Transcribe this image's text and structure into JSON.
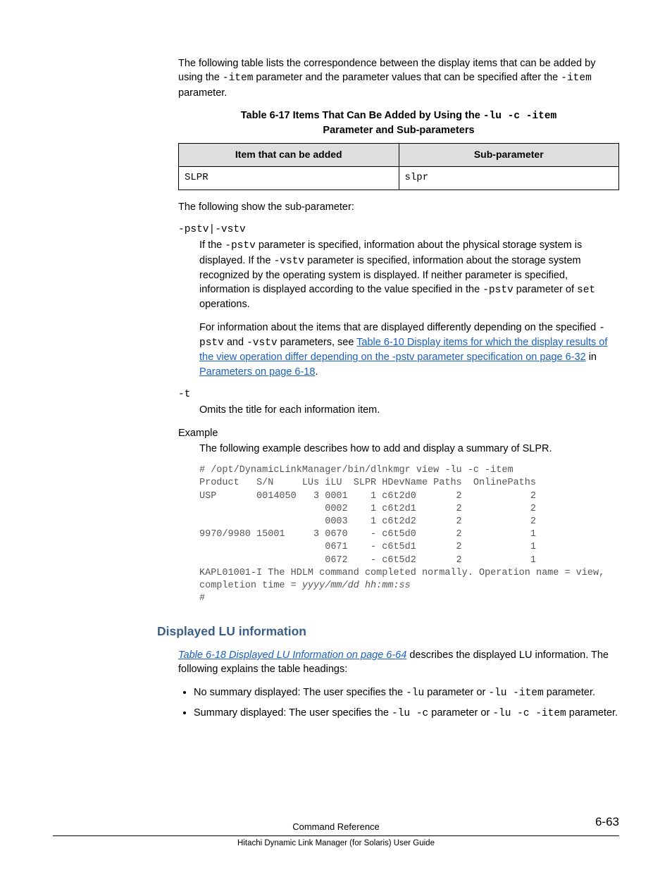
{
  "intro": {
    "p1a": "The following table lists the correspondence between the display items that can be added by using the ",
    "p1_code1": "-item",
    "p1b": " parameter and the parameter values that can be specified after the ",
    "p1_code2": "-item",
    "p1c": " parameter."
  },
  "table617": {
    "caption_a": "Table 6-17 Items That Can Be Added by Using the ",
    "caption_code": "-lu -c -item",
    "caption_b": " Parameter and Sub-parameters",
    "head_item": "Item that can be added",
    "head_sub": "Sub-parameter",
    "row1_item": "SLPR",
    "row1_sub": "slpr"
  },
  "subparam_intro": "The following show the sub-parameter:",
  "pstv": {
    "label": "-pstv|-vstv",
    "p1a": "If the ",
    "p1_c1": "-pstv",
    "p1b": " parameter is specified, information about the physical storage system is displayed. If the ",
    "p1_c2": "-vstv",
    "p1c": " parameter is specified, information about the storage system recognized by the operating system is displayed. If neither parameter is specified, information is displayed according to the value specified in the ",
    "p1_c3": "-pstv",
    "p1d": " parameter of ",
    "p1_c4": "set",
    "p1e": " operations.",
    "p2a": "For information about the items that are displayed differently depending on the specified ",
    "p2_c1": "-pstv",
    "p2b": " and ",
    "p2_c2": "-vstv",
    "p2c": " parameters, see ",
    "p2_link1": "Table 6-10 Display items for which the display results of the view operation differ depending on the -pstv parameter specification on page 6-32",
    "p2d": " in ",
    "p2_link2": "Parameters on page 6-18",
    "p2e": "."
  },
  "t_opt": {
    "label": "-t",
    "desc": "Omits the title for each information item."
  },
  "example": {
    "label": "Example",
    "desc": "The following example describes how to add and display a summary of SLPR.",
    "pre_a": "# /opt/DynamicLinkManager/bin/dlnkmgr view -lu -c -item\nProduct   S/N     LUs iLU  SLPR HDevName Paths  OnlinePaths\nUSP       0014050   3 0001    1 c6t2d0       2            2\n                      0002    1 c6t2d1       2            2\n                      0003    1 c6t2d2       2            2\n9970/9980 15001     3 0670    - c6t5d0       2            1\n                      0671    - c6t5d1       2            1\n                      0672    - c6t5d2       2            1\nKAPL01001-I The HDLM command completed normally. Operation name = view,\ncompletion time = ",
    "pre_it": "yyyy/mm/dd hh:mm:ss",
    "pre_b": "\n#"
  },
  "displayed_lu": {
    "heading": "Displayed LU information",
    "p1_link": "Table 6-18 Displayed LU Information on page 6-64",
    "p1b": " describes the displayed LU information. The following explains the table headings:",
    "b1a": "No summary displayed: The user specifies the ",
    "b1_c1": "-lu",
    "b1b": " parameter or ",
    "b1_c2": "-lu -item",
    "b1c": " parameter.",
    "b2a": "Summary displayed: The user specifies the ",
    "b2_c1": "-lu -c",
    "b2b": " parameter or ",
    "b2_c2": "-lu -c -item",
    "b2c": " parameter."
  },
  "footer": {
    "line1": "Command Reference",
    "page": "6-63",
    "line2": "Hitachi Dynamic Link Manager (for Solaris) User Guide"
  }
}
